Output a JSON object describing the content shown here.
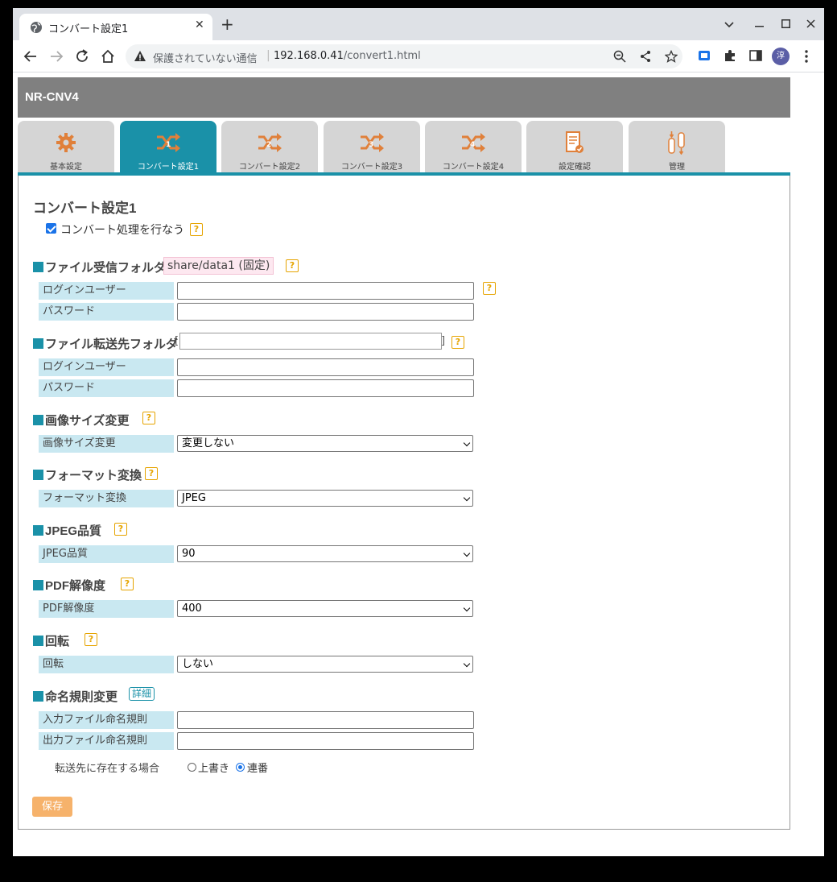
{
  "browser": {
    "tab_title": "コンバート設定1",
    "not_secure": "保護されていない通信",
    "url_host": "192.168.0.41",
    "url_path": "/convert1.html",
    "profile_initial": "淳"
  },
  "app": {
    "title": "NR-CNV4",
    "tabs": [
      {
        "label": "基本設定",
        "icon": "gear-icon"
      },
      {
        "label": "コンバート設定1",
        "icon": "shuffle-1-icon"
      },
      {
        "label": "コンバート設定2",
        "icon": "shuffle-2-icon"
      },
      {
        "label": "コンバート設定3",
        "icon": "shuffle-3-icon"
      },
      {
        "label": "コンバート設定4",
        "icon": "shuffle-4-icon"
      },
      {
        "label": "設定確認",
        "icon": "document-check-icon"
      },
      {
        "label": "管理",
        "icon": "cylinders-icon"
      }
    ]
  },
  "page": {
    "heading": "コンバート設定1",
    "enable_label": "コンバート処理を行なう",
    "help_mark": "?",
    "receive": {
      "title": "ファイル受信フォルダ",
      "fixed_path": "share/data1 (固定)",
      "user_label": "ログインユーザー",
      "pass_label": "パスワード"
    },
    "transfer": {
      "title": "ファイル転送先フォルダ",
      "open_bracket": "[",
      "close_bracket": "]",
      "user_label": "ログインユーザー",
      "pass_label": "パスワード"
    },
    "resize": {
      "title": "画像サイズ変更",
      "label": "画像サイズ変更",
      "value": "変更しない"
    },
    "format": {
      "title": "フォーマット変換",
      "label": "フォーマット変換",
      "value": "JPEG"
    },
    "jpeg": {
      "title": "JPEG品質",
      "label": "JPEG品質",
      "value": "90"
    },
    "pdf": {
      "title": "PDF解像度",
      "label": "PDF解像度",
      "value": "400"
    },
    "rotate": {
      "title": "回転",
      "label": "回転",
      "value": "しない"
    },
    "naming": {
      "title": "命名規則変更",
      "detail": "詳細",
      "input_label": "入力ファイル命名規則",
      "output_label": "出力ファイル命名規則",
      "exist_label": "転送先に存在する場合",
      "overwrite": "上書き",
      "serial": "連番"
    },
    "save": "保存"
  },
  "colors": {
    "accent": "#1a91a8",
    "help": "#e6a400",
    "label_bg": "#c9e8f1",
    "save": "#f6b26b"
  }
}
